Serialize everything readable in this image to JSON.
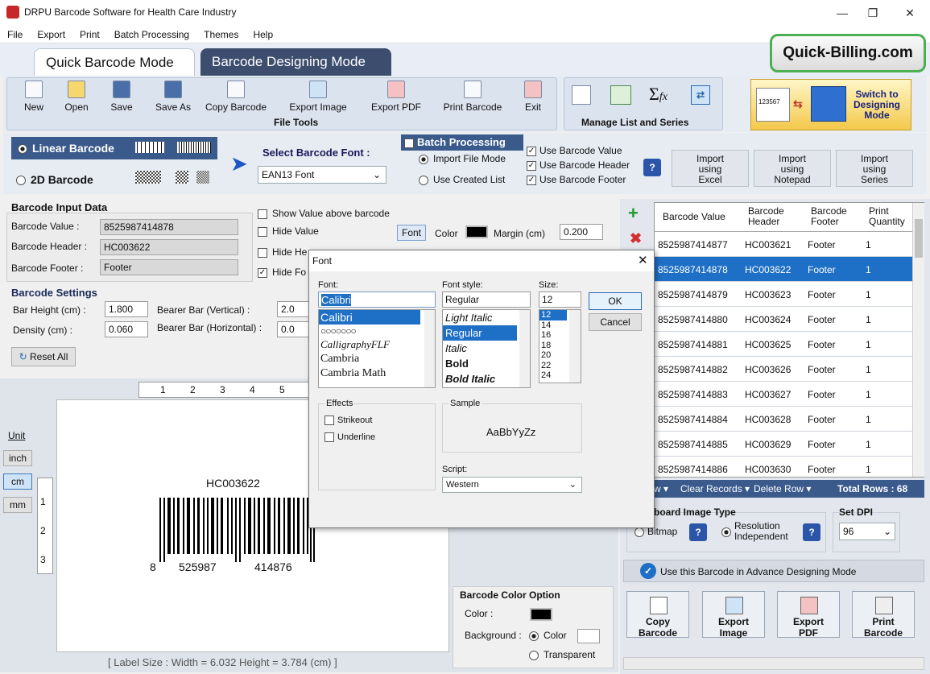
{
  "window": {
    "title": "DRPU Barcode Software for Health Care Industry"
  },
  "menu": [
    "File",
    "Export",
    "Print",
    "Batch Processing",
    "Themes",
    "Help"
  ],
  "tabs": {
    "quick": "Quick Barcode Mode",
    "designing": "Barcode Designing Mode"
  },
  "brand": "Quick-Billing.com",
  "toolbar": {
    "file_tools": [
      "New",
      "Open",
      "Save",
      "Save As",
      "Copy Barcode",
      "Export Image",
      "Export PDF",
      "Print Barcode",
      "Exit"
    ],
    "file_tools_label": "File Tools",
    "manage_label": "Manage List and Series",
    "switch_label": "Switch to Designing Mode",
    "thumb_value": "123567"
  },
  "barcode_type": {
    "linear": "Linear Barcode",
    "twod": "2D Barcode"
  },
  "font_select": {
    "label": "Select Barcode Font :",
    "value": "EAN13 Font"
  },
  "batch": {
    "title": "Batch Processing",
    "import_file": "Import File Mode",
    "use_created": "Use Created List",
    "use_value": "Use Barcode Value",
    "use_header": "Use Barcode Header",
    "use_footer": "Use Barcode Footer",
    "help": "?"
  },
  "imports": [
    {
      "line1": "Import",
      "line2": "using",
      "line3": "Excel"
    },
    {
      "line1": "Import",
      "line2": "using",
      "line3": "Notepad"
    },
    {
      "line1": "Import",
      "line2": "using",
      "line3": "Series"
    }
  ],
  "input": {
    "title": "Barcode Input Data",
    "value_label": "Barcode Value :",
    "value": "8525987414878",
    "header_label": "Barcode Header :",
    "header": "HC003622",
    "footer_label": "Barcode Footer :",
    "footer": "Footer"
  },
  "options": {
    "show_above": "Show Value above barcode",
    "hide_value": "Hide Value",
    "hide_header": "Hide He",
    "hide_footer": "Hide Fo",
    "font": "Font",
    "color": "Color",
    "margin": "Margin (cm)",
    "margin_value": "0.200"
  },
  "settings": {
    "title": "Barcode Settings",
    "bar_height_label": "Bar Height (cm) :",
    "bar_height": "1.800",
    "density_label": "Density (cm) :",
    "density": "0.060",
    "bearer_v_label": "Bearer Bar (Vertical) :",
    "bearer_v": "2.0",
    "bearer_h_label": "Bearer Bar (Horizontal) :",
    "bearer_h": "0.0",
    "reset": "Reset All"
  },
  "units": {
    "label": "Unit",
    "inch": "inch",
    "cm": "cm",
    "mm": "mm"
  },
  "ruler": {
    "top": [
      "1",
      "2",
      "3",
      "4",
      "5"
    ],
    "left": [
      "1",
      "2",
      "3"
    ]
  },
  "preview": {
    "header": "HC003622",
    "digit1": "8",
    "group1": "525987",
    "group2": "414876"
  },
  "label_size": "[ Label Size : Width = 6.032  Height = 3.784 (cm) ]",
  "color_option": {
    "title": "Barcode Color Option",
    "color": "Color :",
    "background": "Background :",
    "bg_color": "Color",
    "transparent": "Transparent"
  },
  "grid": {
    "headers": [
      "Barcode Value",
      "Barcode Header",
      "Barcode Footer",
      "Print Quantity"
    ],
    "rows": [
      [
        "8525987414877",
        "HC003621",
        "Footer",
        "1"
      ],
      [
        "8525987414878",
        "HC003622",
        "Footer",
        "1"
      ],
      [
        "8525987414879",
        "HC003623",
        "Footer",
        "1"
      ],
      [
        "8525987414880",
        "HC003624",
        "Footer",
        "1"
      ],
      [
        "8525987414881",
        "HC003625",
        "Footer",
        "1"
      ],
      [
        "8525987414882",
        "HC003626",
        "Footer",
        "1"
      ],
      [
        "8525987414883",
        "HC003627",
        "Footer",
        "1"
      ],
      [
        "8525987414884",
        "HC003628",
        "Footer",
        "1"
      ],
      [
        "8525987414885",
        "HC003629",
        "Footer",
        "1"
      ],
      [
        "8525987414886",
        "HC003630",
        "Footer",
        "1"
      ]
    ],
    "selected_index": 1
  },
  "grid_actions": {
    "view": "w ▾",
    "clear": "Clear Records ▾",
    "delete": "Delete Row ▾",
    "total": "Total Rows : 68"
  },
  "clipboard": {
    "title": "board Image Type",
    "bitmap": "Bitmap",
    "resolution": "Resolution Independent",
    "dpi_label": "Set DPI",
    "dpi": "96"
  },
  "advance": "Use this Barcode in Advance Designing Mode",
  "actions": [
    {
      "l1": "Copy",
      "l2": "Barcode"
    },
    {
      "l1": "Export",
      "l2": "Image"
    },
    {
      "l1": "Export",
      "l2": "PDF"
    },
    {
      "l1": "Print",
      "l2": "Barcode"
    }
  ],
  "font_dialog": {
    "title": "Font",
    "font_label": "Font:",
    "font_value": "Calibri",
    "fonts": [
      "Calibri",
      "○○○○○○○",
      "CalligraphyFLF",
      "Cambria",
      "Cambria Math"
    ],
    "style_label": "Font style:",
    "style_value": "Regular",
    "styles": [
      "Light Italic",
      "Regular",
      "Italic",
      "Bold",
      "Bold Italic"
    ],
    "size_label": "Size:",
    "size_value": "12",
    "sizes": [
      "12",
      "14",
      "16",
      "18",
      "20",
      "22",
      "24"
    ],
    "ok": "OK",
    "cancel": "Cancel",
    "effects": "Effects",
    "strikeout": "Strikeout",
    "underline": "Underline",
    "sample": "Sample",
    "sample_text": "AaBbYyZz",
    "script_label": "Script:",
    "script": "Western"
  },
  "colors": {
    "accent": "#3a5a8c",
    "selection": "#1e6fc6",
    "brand_border": "#4caf50"
  }
}
